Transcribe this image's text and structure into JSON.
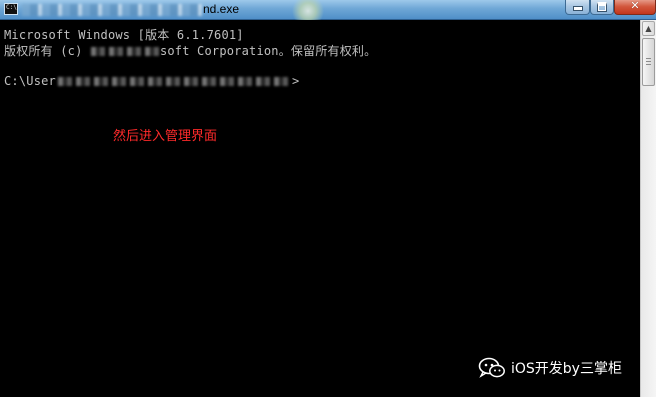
{
  "window": {
    "title_visible": "nd.exe",
    "minimize_glyph": "—",
    "maximize_glyph": "□",
    "close_glyph": "✕",
    "icon": "console-icon"
  },
  "console": {
    "line1": "Microsoft Windows [版本 6.1.7601]",
    "line2_start": "版权所有 (c) ",
    "line2_end": "soft Corporation。保留所有权利。",
    "line3_start": "C:\\User",
    "line3_end": ">",
    "text_color": "#c0c0c0",
    "background": "#000000"
  },
  "annotation": {
    "text": "然后进入管理界面",
    "color": "#ff2a2a"
  },
  "watermark": {
    "text": "iOS开发by三掌柜",
    "icon": "wechat-icon"
  },
  "scrollbar": {
    "up_arrow": "▲"
  }
}
